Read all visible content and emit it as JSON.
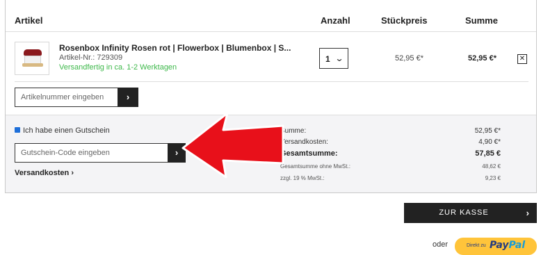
{
  "header": {
    "article": "Artikel",
    "quantity": "Anzahl",
    "unit_price": "Stückpreis",
    "sum": "Summe"
  },
  "item": {
    "name": "Rosenbox Infinity Rosen rot | Flowerbox | Blumenbox | S...",
    "article_nr": "Artikel-Nr.: 729309",
    "shipping": "Versandfertig in ca. 1-2 Werktagen",
    "quantity": "1",
    "unit_price": "52,95 €*",
    "total": "52,95 €*",
    "remove_icon": "close-icon"
  },
  "article_add": {
    "placeholder": "Artikelnummer eingeben",
    "button_icon": "chevron-right-icon"
  },
  "voucher": {
    "checkbox_label": "Ich habe einen Gutschein",
    "checked": true,
    "placeholder": "Gutschein-Code eingeben",
    "button_icon": "chevron-right-icon"
  },
  "shipping_link": "Versandkosten ›",
  "summary": {
    "sum_label": "Summe:",
    "sum_value": "52,95 €*",
    "shipping_label": "Versandkosten:",
    "shipping_value": "4,90 €*",
    "total_label": "Gesamtsumme:",
    "total_value": "57,85 €",
    "net_label": "Gesamtsumme ohne MwSt.:",
    "net_value": "48,62 €",
    "vat_label": "zzgl. 19 % MwSt.:",
    "vat_value": "9,23 €"
  },
  "checkout": {
    "label": "ZUR KASSE",
    "chevron": "›"
  },
  "or_label": "oder",
  "paypal": {
    "direct": "Direkt zu",
    "brand_a": "Pay",
    "brand_b": "Pal"
  },
  "colors": {
    "accent_dark": "#222222",
    "shipping_green": "#3db84a",
    "arrow_red": "#e8101a",
    "paypal_yellow": "#ffc43a"
  }
}
